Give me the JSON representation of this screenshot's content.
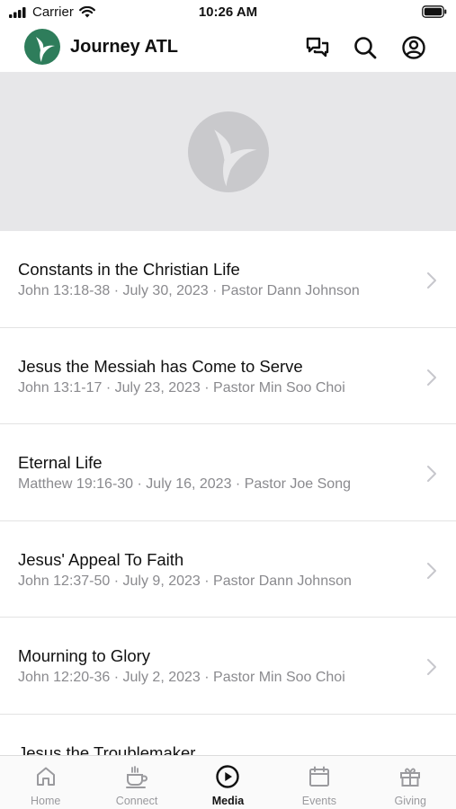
{
  "status_bar": {
    "carrier": "Carrier",
    "time": "10:26 AM"
  },
  "header": {
    "title": "Journey ATL",
    "brand_color": "#2e7d5b"
  },
  "sermons": [
    {
      "title": "Constants in the Christian Life",
      "meta": "John 13:18-38 · July 30, 2023 · Pastor Dann Johnson"
    },
    {
      "title": "Jesus the Messiah has Come to Serve",
      "meta": "John 13:1-17 · July 23, 2023 · Pastor Min Soo Choi"
    },
    {
      "title": "Eternal Life",
      "meta": "Matthew 19:16-30 · July 16, 2023 · Pastor Joe Song"
    },
    {
      "title": "Jesus' Appeal To Faith",
      "meta": "John 12:37-50 · July 9, 2023 · Pastor Dann Johnson"
    },
    {
      "title": "Mourning to Glory",
      "meta": "John 12:20-36 · July 2, 2023 · Pastor Min Soo Choi"
    },
    {
      "title": "Jesus the Troublemaker",
      "meta": ""
    }
  ],
  "tabs": [
    {
      "label": "Home",
      "icon": "home-icon"
    },
    {
      "label": "Connect",
      "icon": "coffee-cup-icon"
    },
    {
      "label": "Media",
      "icon": "play-circle-icon",
      "active": true
    },
    {
      "label": "Events",
      "icon": "calendar-icon"
    },
    {
      "label": "Giving",
      "icon": "gift-icon"
    }
  ]
}
